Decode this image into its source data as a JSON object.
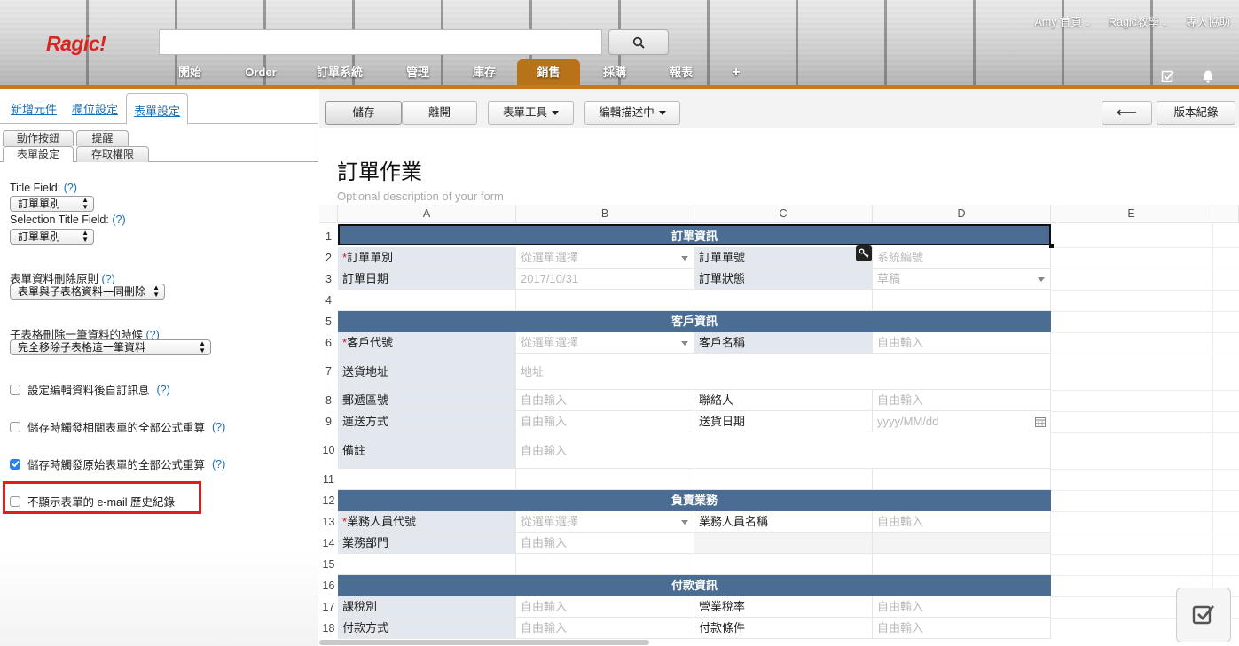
{
  "header": {
    "logo": "Ragic!",
    "search_placeholder": "",
    "top_links": [
      "Amy 首頁",
      "Ragic教學",
      "專人協助"
    ],
    "nav": [
      "開始",
      "Order",
      "訂單系統",
      "管理",
      "庫存",
      "銷售",
      "採購",
      "報表",
      "+"
    ],
    "active_nav": "銷售"
  },
  "left_panel": {
    "tabs": [
      "新增元件",
      "欄位設定",
      "表單設定"
    ],
    "active_tab": "表單設定",
    "subtabs_row1": [
      "動作按鈕",
      "提醒"
    ],
    "subtabs_row2": [
      "表單設定",
      "存取權限"
    ],
    "fields": {
      "title_field_label": "Title Field:",
      "title_field_value": "訂單單別",
      "selection_title_label": "Selection Title Field:",
      "selection_title_value": "訂單單別",
      "delete_rule_label": "表單資料刪除原則",
      "delete_rule_value": "表單與子表格資料一同刪除",
      "subtable_delete_label": "子表格刪除一筆資料的時候",
      "subtable_delete_value": "完全移除子表格這一筆資料",
      "help": "(?)"
    },
    "checkboxes": [
      {
        "label": "設定編輯資料後自訂訊息",
        "checked": false
      },
      {
        "label": "儲存時觸發相關表單的全部公式重算",
        "checked": false
      },
      {
        "label": "儲存時觸發原始表單的全部公式重算",
        "checked": true
      },
      {
        "label": "不顯示表單的 e-mail 歷史紀錄",
        "checked": false
      }
    ]
  },
  "toolbar": {
    "save": "儲存",
    "leave": "離開",
    "form_tools": "表單工具",
    "edit_desc": "編輯描述中",
    "back_arrow": "⟵",
    "version": "版本紀錄"
  },
  "form": {
    "title": "訂單作業",
    "description": "Optional description of your form",
    "columns": [
      "A",
      "B",
      "C",
      "D",
      "E"
    ],
    "rows": [
      "1",
      "2",
      "3",
      "4",
      "5",
      "6",
      "7",
      "8",
      "9",
      "10",
      "11",
      "12",
      "13",
      "14",
      "15",
      "16",
      "17",
      "18"
    ],
    "sections": [
      "訂單資訊",
      "客戶資訊",
      "負責業務",
      "付款資訊"
    ],
    "cells": {
      "r2a": "訂單單別",
      "r2b": "從選單選擇",
      "r2c": "訂單單號",
      "r2d": "系統編號",
      "r3a": "訂單日期",
      "r3b": "2017/10/31",
      "r3c": "訂單狀態",
      "r3d": "草稿",
      "r6a": "客戶代號",
      "r6b": "從選單選擇",
      "r6c": "客戶名稱",
      "r6d": "自由輸入",
      "r7a": "送貨地址",
      "r7b": "地址",
      "r8a": "郵遞區號",
      "r8b": "自由輸入",
      "r8c": "聯絡人",
      "r8d": "自由輸入",
      "r9a": "運送方式",
      "r9b": "自由輸入",
      "r9c": "送貨日期",
      "r9d": "yyyy/MM/dd",
      "r10a": "備註",
      "r10b": "自由輸入",
      "r13a": "業務人員代號",
      "r13b": "從選單選擇",
      "r13c": "業務人員名稱",
      "r13d": "自由輸入",
      "r14a": "業務部門",
      "r14b": "自由輸入",
      "r17a": "課稅別",
      "r17b": "自由輸入",
      "r17c": "營業稅率",
      "r17d": "自由輸入",
      "r18a": "付款方式",
      "r18b": "自由輸入",
      "r18c": "付款條件",
      "r18d": "自由輸入"
    },
    "required_mark": "*"
  },
  "colors": {
    "section": "#4b6d93",
    "accent": "#b8731a",
    "label_bg": "#e3e8ef",
    "highlight": "#e21b1b"
  }
}
